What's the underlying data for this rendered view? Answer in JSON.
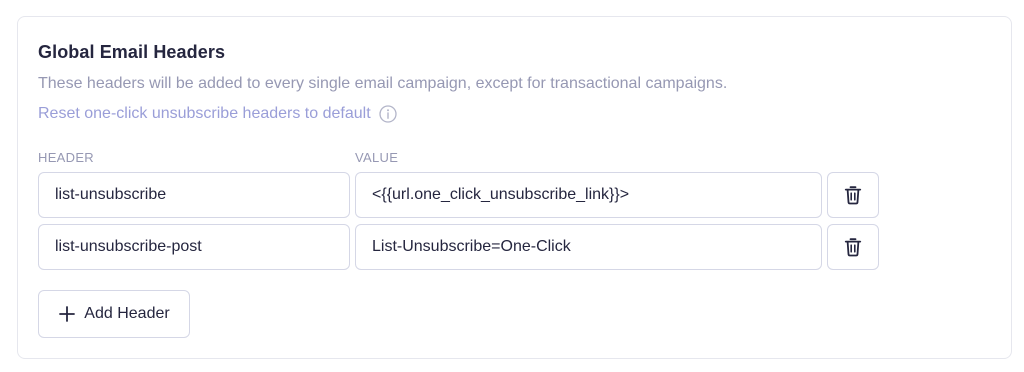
{
  "section": {
    "title": "Global Email Headers",
    "description": "These headers will be added to every single email campaign, except for transactional campaigns.",
    "reset_link": "Reset one-click unsubscribe headers to default",
    "info_icon": "info-icon"
  },
  "table": {
    "columns": {
      "header": "HEADER",
      "value": "VALUE"
    },
    "rows": [
      {
        "header": "list-unsubscribe",
        "value": "<{{url.one_click_unsubscribe_link}}>",
        "delete_icon": "trash-icon"
      },
      {
        "header": "list-unsubscribe-post",
        "value": "List-Unsubscribe=One-Click",
        "delete_icon": "trash-icon"
      }
    ]
  },
  "actions": {
    "add_label": "Add Header",
    "add_icon": "plus-icon"
  },
  "colors": {
    "text": "#25263f",
    "muted": "#9698b3",
    "link": "#9a9ed8",
    "border": "#d5d7e6"
  }
}
